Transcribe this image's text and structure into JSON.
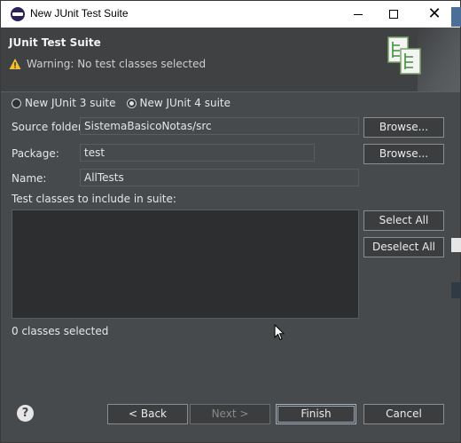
{
  "window": {
    "title": "New JUnit Test Suite"
  },
  "banner": {
    "title": "JUnit Test Suite",
    "warning": "Warning: No test classes selected"
  },
  "radios": [
    {
      "label": "New JUnit 3 suite",
      "selected": false
    },
    {
      "label": "New JUnit 4 suite",
      "selected": true
    }
  ],
  "form": {
    "source_folder_label": "Source folder:",
    "source_folder_value": "SistemaBasicoNotas/src",
    "package_label": "Package:",
    "package_value": "test",
    "name_label": "Name:",
    "name_value": "AllTests",
    "browse_label": "Browse...",
    "classes_label": "Test classes to include in suite:",
    "select_all": "Select All",
    "deselect_all": "Deselect All",
    "status": "0 classes selected"
  },
  "footer": {
    "back": "< Back",
    "next": "Next >",
    "finish": "Finish",
    "cancel": "Cancel",
    "help": "?"
  },
  "icons": [
    "junit-app-icon",
    "minimize-icon",
    "maximize-icon",
    "close-icon",
    "warning-icon",
    "test-suite-banner-icon",
    "help-icon",
    "mouse-cursor-icon"
  ]
}
